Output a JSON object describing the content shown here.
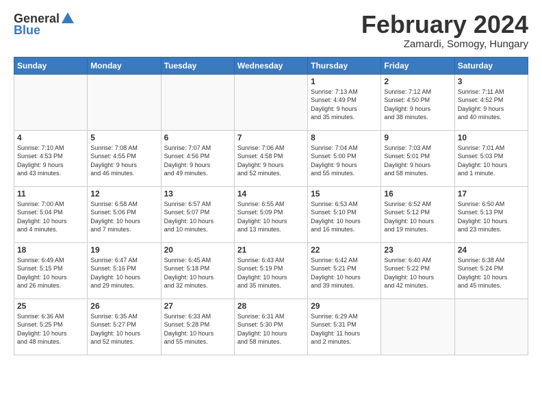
{
  "logo": {
    "general": "General",
    "blue": "Blue"
  },
  "header": {
    "month": "February 2024",
    "location": "Zamardi, Somogy, Hungary"
  },
  "weekdays": [
    "Sunday",
    "Monday",
    "Tuesday",
    "Wednesday",
    "Thursday",
    "Friday",
    "Saturday"
  ],
  "weeks": [
    [
      {
        "day": "",
        "info": ""
      },
      {
        "day": "",
        "info": ""
      },
      {
        "day": "",
        "info": ""
      },
      {
        "day": "",
        "info": ""
      },
      {
        "day": "1",
        "info": "Sunrise: 7:13 AM\nSunset: 4:49 PM\nDaylight: 9 hours\nand 35 minutes."
      },
      {
        "day": "2",
        "info": "Sunrise: 7:12 AM\nSunset: 4:50 PM\nDaylight: 9 hours\nand 38 minutes."
      },
      {
        "day": "3",
        "info": "Sunrise: 7:11 AM\nSunset: 4:52 PM\nDaylight: 9 hours\nand 40 minutes."
      }
    ],
    [
      {
        "day": "4",
        "info": "Sunrise: 7:10 AM\nSunset: 4:53 PM\nDaylight: 9 hours\nand 43 minutes."
      },
      {
        "day": "5",
        "info": "Sunrise: 7:08 AM\nSunset: 4:55 PM\nDaylight: 9 hours\nand 46 minutes."
      },
      {
        "day": "6",
        "info": "Sunrise: 7:07 AM\nSunset: 4:56 PM\nDaylight: 9 hours\nand 49 minutes."
      },
      {
        "day": "7",
        "info": "Sunrise: 7:06 AM\nSunset: 4:58 PM\nDaylight: 9 hours\nand 52 minutes."
      },
      {
        "day": "8",
        "info": "Sunrise: 7:04 AM\nSunset: 5:00 PM\nDaylight: 9 hours\nand 55 minutes."
      },
      {
        "day": "9",
        "info": "Sunrise: 7:03 AM\nSunset: 5:01 PM\nDaylight: 9 hours\nand 58 minutes."
      },
      {
        "day": "10",
        "info": "Sunrise: 7:01 AM\nSunset: 5:03 PM\nDaylight: 10 hours\nand 1 minute."
      }
    ],
    [
      {
        "day": "11",
        "info": "Sunrise: 7:00 AM\nSunset: 5:04 PM\nDaylight: 10 hours\nand 4 minutes."
      },
      {
        "day": "12",
        "info": "Sunrise: 6:58 AM\nSunset: 5:06 PM\nDaylight: 10 hours\nand 7 minutes."
      },
      {
        "day": "13",
        "info": "Sunrise: 6:57 AM\nSunset: 5:07 PM\nDaylight: 10 hours\nand 10 minutes."
      },
      {
        "day": "14",
        "info": "Sunrise: 6:55 AM\nSunset: 5:09 PM\nDaylight: 10 hours\nand 13 minutes."
      },
      {
        "day": "15",
        "info": "Sunrise: 6:53 AM\nSunset: 5:10 PM\nDaylight: 10 hours\nand 16 minutes."
      },
      {
        "day": "16",
        "info": "Sunrise: 6:52 AM\nSunset: 5:12 PM\nDaylight: 10 hours\nand 19 minutes."
      },
      {
        "day": "17",
        "info": "Sunrise: 6:50 AM\nSunset: 5:13 PM\nDaylight: 10 hours\nand 23 minutes."
      }
    ],
    [
      {
        "day": "18",
        "info": "Sunrise: 6:49 AM\nSunset: 5:15 PM\nDaylight: 10 hours\nand 26 minutes."
      },
      {
        "day": "19",
        "info": "Sunrise: 6:47 AM\nSunset: 5:16 PM\nDaylight: 10 hours\nand 29 minutes."
      },
      {
        "day": "20",
        "info": "Sunrise: 6:45 AM\nSunset: 5:18 PM\nDaylight: 10 hours\nand 32 minutes."
      },
      {
        "day": "21",
        "info": "Sunrise: 6:43 AM\nSunset: 5:19 PM\nDaylight: 10 hours\nand 35 minutes."
      },
      {
        "day": "22",
        "info": "Sunrise: 6:42 AM\nSunset: 5:21 PM\nDaylight: 10 hours\nand 39 minutes."
      },
      {
        "day": "23",
        "info": "Sunrise: 6:40 AM\nSunset: 5:22 PM\nDaylight: 10 hours\nand 42 minutes."
      },
      {
        "day": "24",
        "info": "Sunrise: 6:38 AM\nSunset: 5:24 PM\nDaylight: 10 hours\nand 45 minutes."
      }
    ],
    [
      {
        "day": "25",
        "info": "Sunrise: 6:36 AM\nSunset: 5:25 PM\nDaylight: 10 hours\nand 48 minutes."
      },
      {
        "day": "26",
        "info": "Sunrise: 6:35 AM\nSunset: 5:27 PM\nDaylight: 10 hours\nand 52 minutes."
      },
      {
        "day": "27",
        "info": "Sunrise: 6:33 AM\nSunset: 5:28 PM\nDaylight: 10 hours\nand 55 minutes."
      },
      {
        "day": "28",
        "info": "Sunrise: 6:31 AM\nSunset: 5:30 PM\nDaylight: 10 hours\nand 58 minutes."
      },
      {
        "day": "29",
        "info": "Sunrise: 6:29 AM\nSunset: 5:31 PM\nDaylight: 11 hours\nand 2 minutes."
      },
      {
        "day": "",
        "info": ""
      },
      {
        "day": "",
        "info": ""
      }
    ]
  ]
}
